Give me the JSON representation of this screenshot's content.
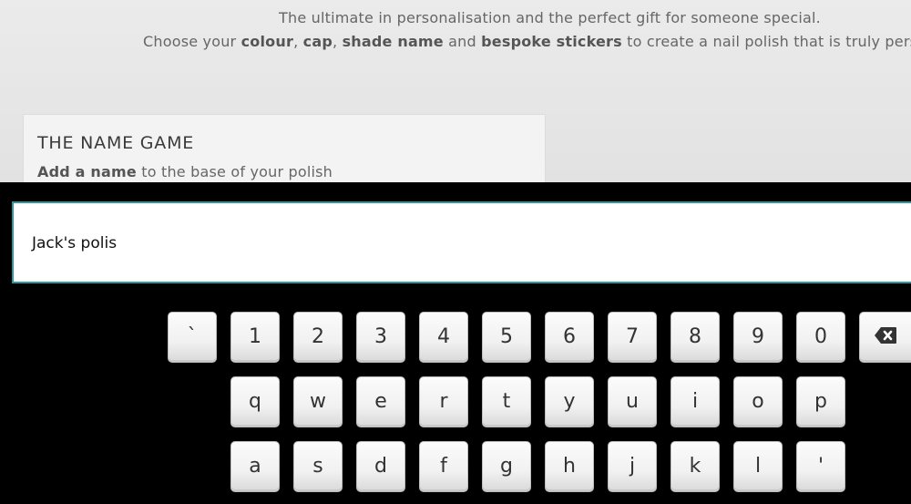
{
  "intro": {
    "line1": "The ultimate in personalisation and the perfect gift for someone special.",
    "line2_prefix": "Choose your ",
    "line2_colour": "colour",
    "line2_comma1": ", ",
    "line2_cap": "cap",
    "line2_comma2": ", ",
    "line2_shade": "shade name",
    "line2_and": " and ",
    "line2_stickers": "bespoke stickers",
    "line2_suffix": " to create a nail polish that is truly perso"
  },
  "panel": {
    "title": "THE NAME GAME",
    "subtitle_bold": "Add a name",
    "subtitle_rest": " to the base of your polish"
  },
  "input": {
    "value": "Jack's polis"
  },
  "keyboard": {
    "row1": [
      "`",
      "1",
      "2",
      "3",
      "4",
      "5",
      "6",
      "7",
      "8",
      "9",
      "0"
    ],
    "row2": [
      "q",
      "w",
      "e",
      "r",
      "t",
      "y",
      "u",
      "i",
      "o",
      "p"
    ],
    "row3": [
      "a",
      "s",
      "d",
      "f",
      "g",
      "h",
      "j",
      "k",
      "l",
      "'"
    ],
    "backspace_icon": "backspace-icon"
  },
  "colors": {
    "field_border": "#2a9aa0",
    "keyboard_bg": "#000000",
    "page_bg": "#e6e6e6"
  }
}
